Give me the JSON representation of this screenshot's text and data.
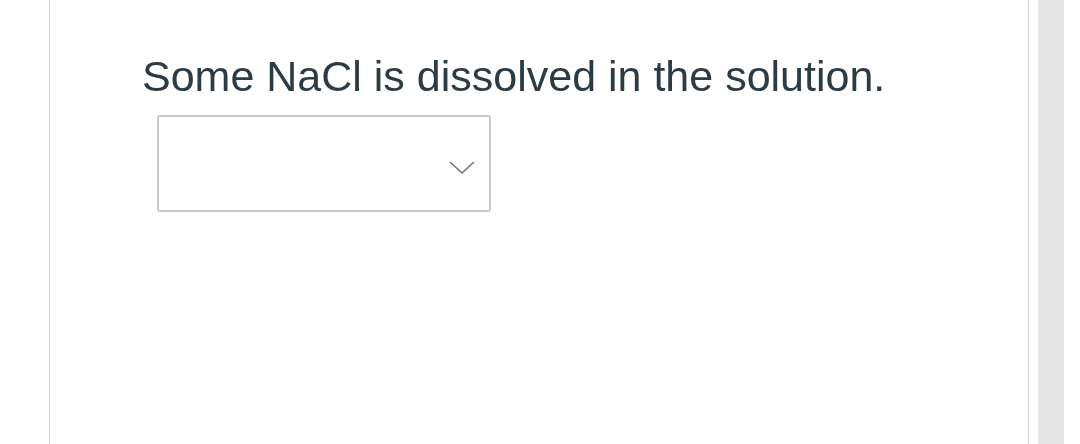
{
  "question": {
    "text": "Some NaCl is dissolved in the solution."
  },
  "answer_select": {
    "kind": "dropdown"
  }
}
